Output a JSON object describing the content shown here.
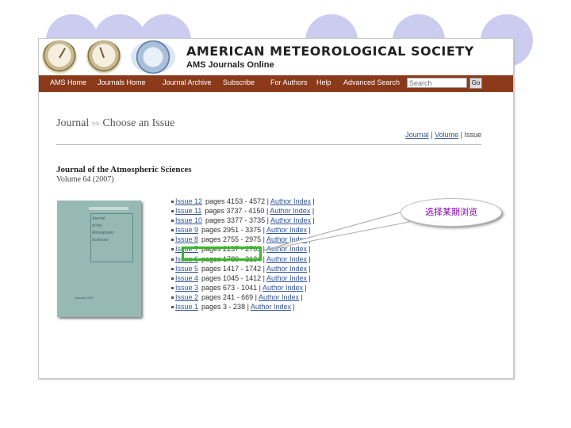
{
  "banner": {
    "org_name": "AMERICAN METEOROLOGICAL SOCIETY",
    "org_sub": "AMS Journals Online"
  },
  "nav": {
    "items": [
      "AMS Home",
      "Journals Home",
      "Journal Archive",
      "Subscribe",
      "For Authors",
      "Help",
      "Advanced Search"
    ],
    "search_placeholder": "Search",
    "go_label": "Go"
  },
  "page": {
    "heading_journal": "Journal",
    "heading_sep": ">>",
    "heading_title": "Choose an Issue",
    "crumbs": {
      "journal": "Journal",
      "volume": "Volume",
      "issue": "Issue",
      "sep": "|"
    }
  },
  "journal": {
    "title": "Journal of the Atmospheric Sciences",
    "volume": "Volume 64 (2007)",
    "cover_title_lines": [
      "Journal",
      "of the",
      "Atmospheric",
      "Sciences"
    ],
    "cover_footer": "January 2007"
  },
  "issues": [
    {
      "label": "Issue 12",
      "pages": "pages 4153 - 4572",
      "index": "Author Index"
    },
    {
      "label": "Issue 11",
      "pages": "pages 3737 - 4150",
      "index": "Author Index"
    },
    {
      "label": "Issue 10",
      "pages": "pages 3377 - 3735",
      "index": "Author Index"
    },
    {
      "label": "Issue 9",
      "pages": "pages 2951 - 3375",
      "index": "Author Index"
    },
    {
      "label": "Issue 8",
      "pages": "pages 2755 - 2975",
      "index": "Author Index"
    },
    {
      "label": "Issue 7",
      "pages": "pages 2137 - 2763",
      "index": "Author Index"
    },
    {
      "label": "Issue 6",
      "pages": "pages 1789 - 2134",
      "index": "Author Index"
    },
    {
      "label": "Issue 5",
      "pages": "pages 1417 - 1742",
      "index": "Author Index"
    },
    {
      "label": "Issue 4",
      "pages": "pages 1045 - 1412",
      "index": "Author Index"
    },
    {
      "label": "Issue 3",
      "pages": "pages 673 - 1041",
      "index": "Author Index"
    },
    {
      "label": "Issue 2",
      "pages": "pages 241 - 669",
      "index": "Author Index"
    },
    {
      "label": "Issue 1",
      "pages": "pages 3 - 238",
      "index": "Author Index"
    }
  ],
  "annotation": {
    "callout_text": "选择某期浏览",
    "highlight_color": "#33bb22",
    "callout_text_color": "#8800aa"
  },
  "colors": {
    "navbar": "#8a3a1a",
    "slide_circles": "#ccccf0"
  }
}
